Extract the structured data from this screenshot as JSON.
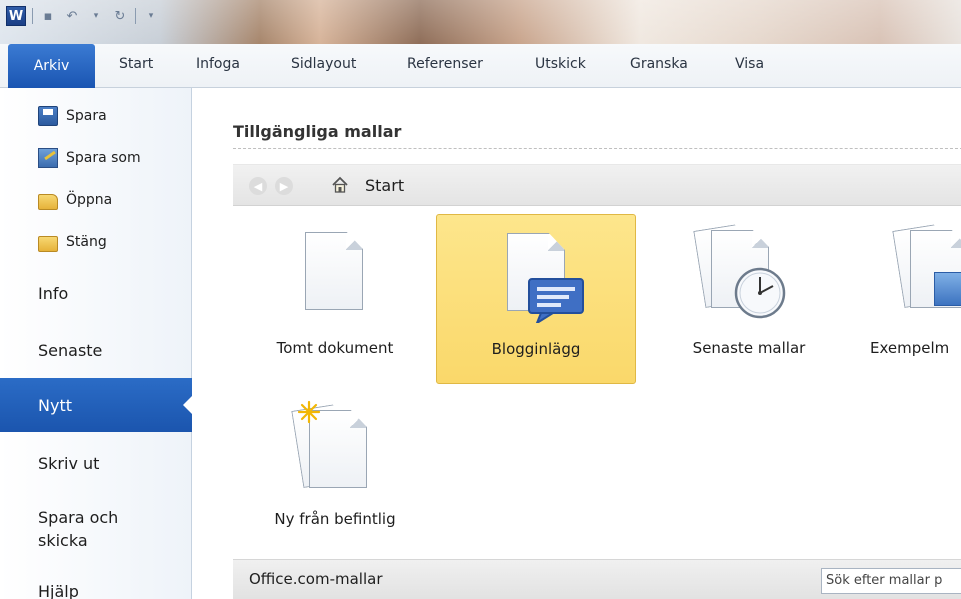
{
  "app": {
    "logo_letter": "W"
  },
  "ribbon": {
    "tabs": [
      {
        "label": "Arkiv"
      },
      {
        "label": "Start"
      },
      {
        "label": "Infoga"
      },
      {
        "label": "Sidlayout"
      },
      {
        "label": "Referenser"
      },
      {
        "label": "Utskick"
      },
      {
        "label": "Granska"
      },
      {
        "label": "Visa"
      }
    ]
  },
  "nav": {
    "commands": [
      {
        "label": "Spara",
        "icon": "save-icon"
      },
      {
        "label": "Spara som",
        "icon": "save-as-icon"
      },
      {
        "label": "Öppna",
        "icon": "open-folder-icon"
      },
      {
        "label": "Stäng",
        "icon": "close-folder-icon"
      }
    ],
    "items": [
      {
        "label": "Info"
      },
      {
        "label": "Senaste"
      },
      {
        "label": "Nytt"
      },
      {
        "label": "Skriv ut"
      },
      {
        "label": "Spara och skicka"
      },
      {
        "label": "Hjälp"
      }
    ],
    "active_index": 2
  },
  "main": {
    "heading": "Tillgängliga mallar",
    "breadcrumb": "Start",
    "tiles": [
      {
        "label": "Tomt dokument",
        "icon": "blank-document-icon"
      },
      {
        "label": "Blogginlägg",
        "icon": "blog-post-icon",
        "selected": true
      },
      {
        "label": "Senaste mallar",
        "icon": "recent-templates-icon"
      },
      {
        "label": "Exempelm",
        "icon": "sample-templates-icon"
      },
      {
        "label": "Ny från befintlig",
        "icon": "new-from-existing-icon"
      }
    ],
    "office_bar": {
      "label": "Office.com-mallar",
      "search_value": "Sök efter mallar p"
    }
  },
  "colors": {
    "accent": "#1b55ae",
    "selection": "#fad86a"
  }
}
